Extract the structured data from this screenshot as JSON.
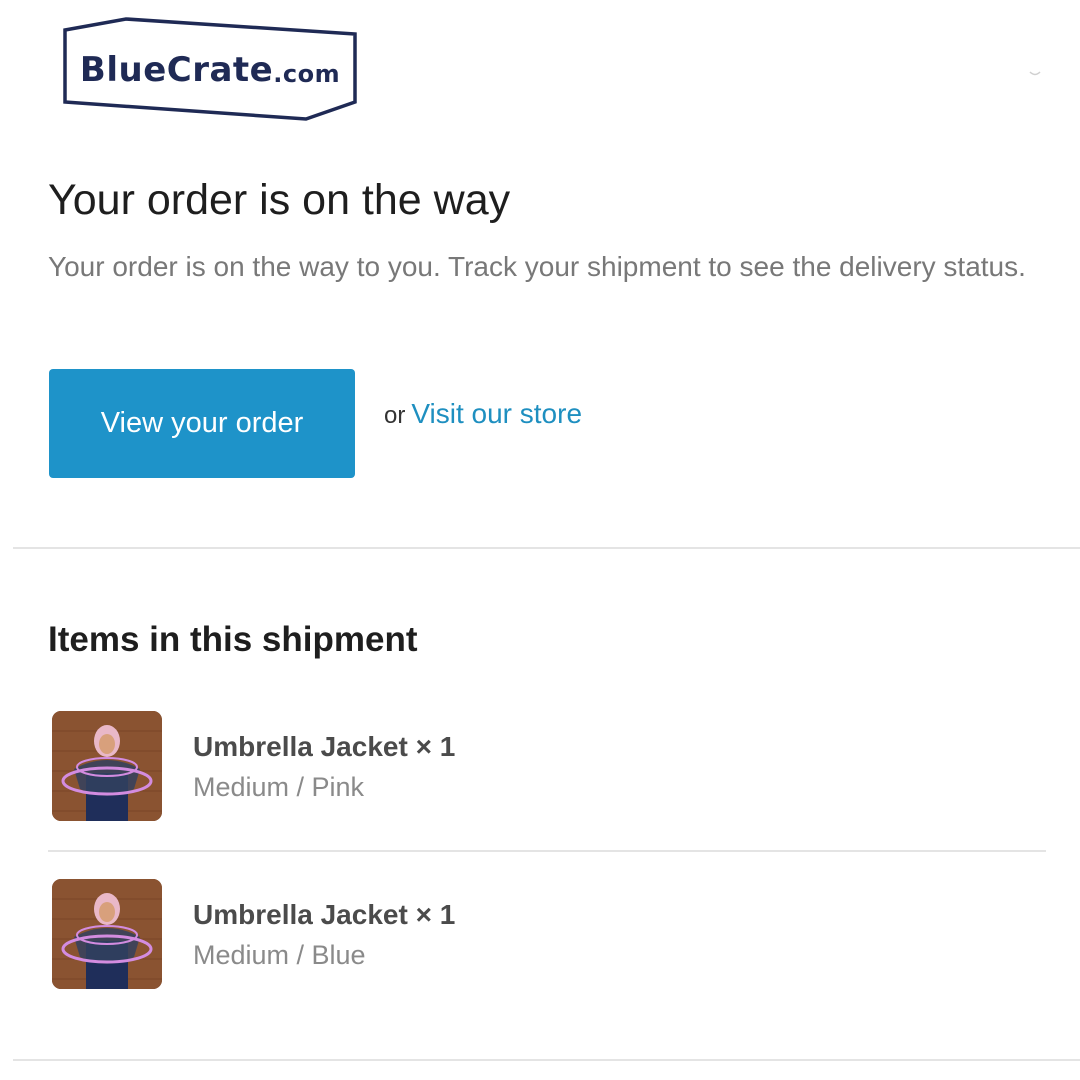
{
  "brand": {
    "logo_name": "BlueCrate",
    "logo_suffix": ".com",
    "colors": {
      "logo": "#1f2a55",
      "accent": "#1e93c9",
      "link": "#1e8fc0"
    }
  },
  "notice": {
    "headline": "Your order is on the way",
    "body": "Your order is on the way to you. Track your shipment to see the delivery status."
  },
  "actions": {
    "primary_label": "View your order",
    "or_text": "or",
    "secondary_link": "Visit our store"
  },
  "shipment": {
    "heading": "Items in this shipment",
    "items": [
      {
        "title": "Umbrella Jacket × 1",
        "variant": "Medium / Pink",
        "image": "umbrella-jacket-photo"
      },
      {
        "title": "Umbrella Jacket × 1",
        "variant": "Medium / Blue",
        "image": "umbrella-jacket-photo"
      }
    ]
  }
}
